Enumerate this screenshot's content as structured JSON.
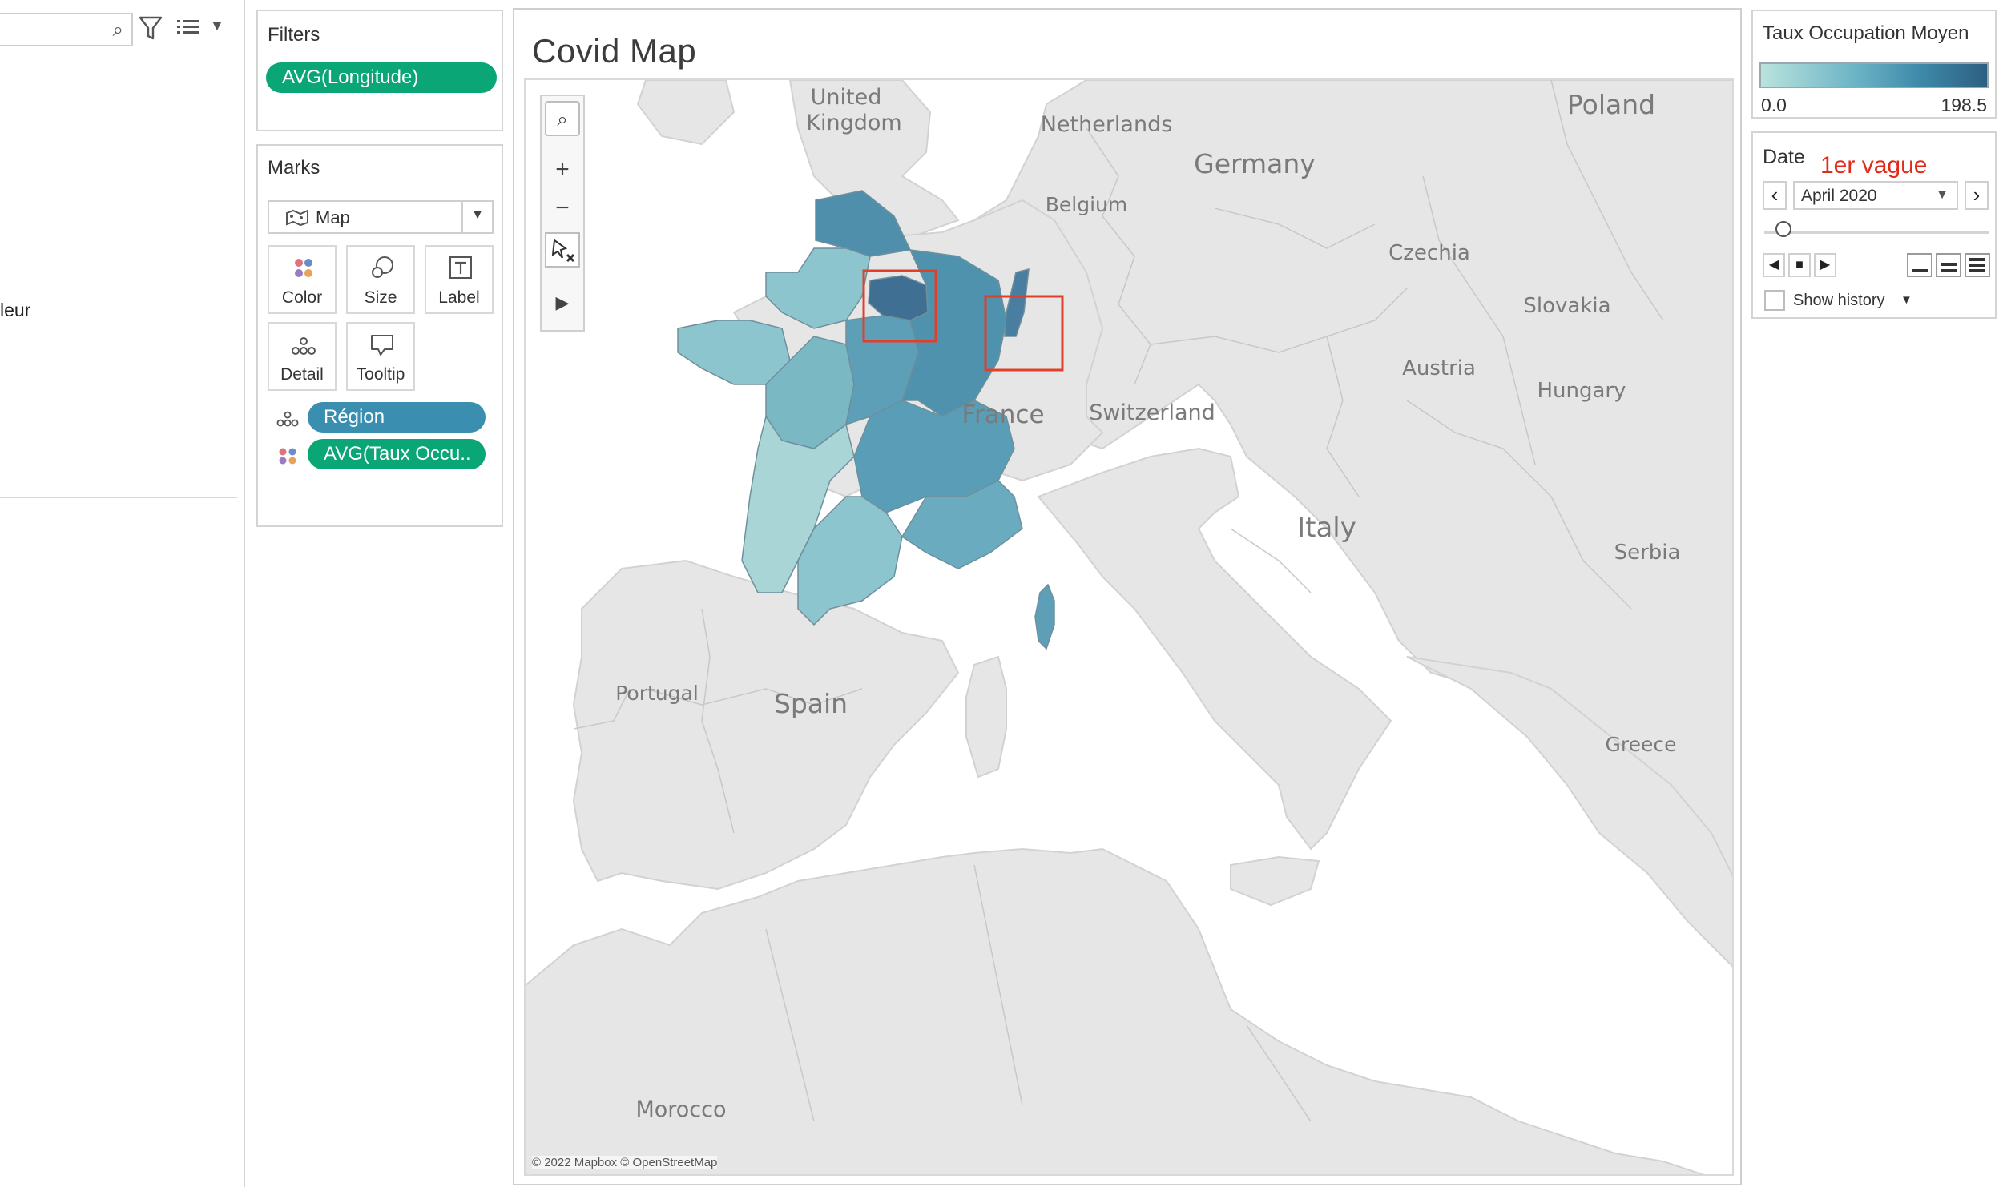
{
  "left_pane": {
    "partial_text": "leur",
    "search_placeholder": ""
  },
  "filters": {
    "title": "Filters",
    "pills": [
      "AVG(Longitude)"
    ]
  },
  "marks": {
    "title": "Marks",
    "mark_type": "Map",
    "buttons": {
      "color": "Color",
      "size": "Size",
      "label": "Label",
      "detail": "Detail",
      "tooltip": "Tooltip"
    },
    "shelf": {
      "detail_pill": "Région",
      "color_pill": "AVG(Taux Occu.."
    },
    "colors": {
      "green_pill": "#0aa676",
      "blue_pill": "#3a8fb0"
    }
  },
  "viz": {
    "title": "Covid Map",
    "attribution": "© 2022 Mapbox © OpenStreetMap",
    "toolbar_icons": [
      "search-icon",
      "zoom-in-icon",
      "zoom-out-icon",
      "pin-reset-icon",
      "expand-arrow-icon"
    ],
    "map_labels": {
      "united_kingdom_1": "United",
      "united_kingdom_2": "Kingdom",
      "netherlands": "Netherlands",
      "poland": "Poland",
      "germany": "Germany",
      "belgium": "Belgium",
      "czechia": "Czechia",
      "slovakia": "Slovakia",
      "austria": "Austria",
      "hungary": "Hungary",
      "france": "France",
      "switzerland": "Switzerland",
      "italy": "Italy",
      "serbia": "Serbia",
      "portugal": "Portugal",
      "spain": "Spain",
      "greece": "Greece",
      "morocco": "Morocco"
    },
    "highlight_color": "#e0402a",
    "region_colors": {
      "ile_de_france": "#3f6f92",
      "grand_est_alsace": "#4a7ea0",
      "hauts_de_france": "#4f8fac",
      "bourgogne": "#4f92ad",
      "auvergne_rhone": "#5a9db6",
      "paca": "#6aabbf",
      "corse": "#5d9fb7",
      "occitanie": "#8cc5cd",
      "nouvelle_aquitaine": "#a9d5d6",
      "pays_de_loire": "#7ab9c4",
      "bretagne": "#8cc5cd",
      "normandie": "#8cc5cd",
      "centre": "#5e9fb8"
    }
  },
  "legend": {
    "title": "Taux Occupation Moyen",
    "min": "0.0",
    "max": "198.5"
  },
  "date_control": {
    "title": "Date",
    "annotation": "1er vague",
    "value": "April 2020",
    "show_history": "Show history"
  }
}
